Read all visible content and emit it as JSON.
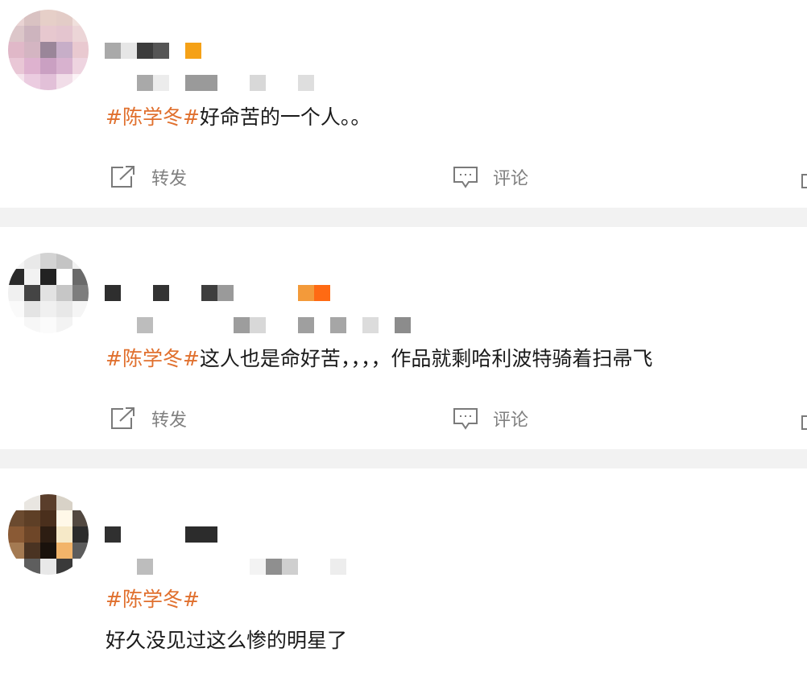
{
  "topic": "#陈学冬#",
  "actions": {
    "repost": "转发",
    "comment": "评论"
  },
  "icons": [
    "share-icon",
    "comment-icon",
    "like-icon"
  ],
  "colors": {
    "topic": "#e0702e",
    "text": "#1a1a1a",
    "action": "#808080",
    "divider": "#f2f2f2",
    "badge": "#f5a117"
  },
  "posts": [
    {
      "text": "好命苦的一个人。。"
    },
    {
      "text": "这人也是命好苦，，，，作品就剩哈利波特骑着扫帚飞"
    },
    {
      "text": "好久没见过这么惨的明星了"
    }
  ]
}
